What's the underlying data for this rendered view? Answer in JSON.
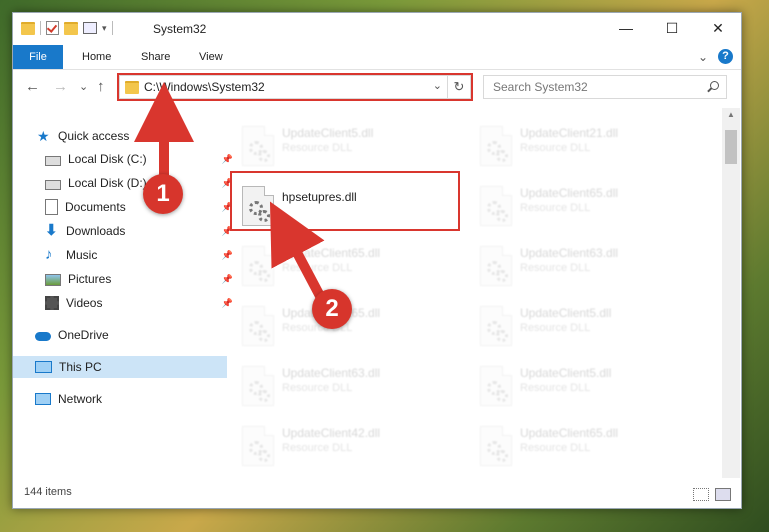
{
  "window": {
    "title": "System32",
    "controls": [
      "—",
      "☐",
      "✕"
    ]
  },
  "ribbon": {
    "tabs": [
      "File",
      "Home",
      "Share",
      "View"
    ],
    "collapse": "⌄",
    "help": "?"
  },
  "navigation": {
    "back": "←",
    "forward": "→",
    "recent": "⌄",
    "up": "↑"
  },
  "address": {
    "path": "C:\\Windows\\System32",
    "dropdown": "⌄",
    "refresh": "↻"
  },
  "search": {
    "placeholder": "Search System32"
  },
  "sidebar": {
    "quick_access": "Quick access",
    "items": [
      {
        "label": "Local Disk (C:)",
        "icon": "drive-icon",
        "pinned": true
      },
      {
        "label": "Local Disk (D:)",
        "icon": "drive-icon",
        "pinned": true
      },
      {
        "label": "Documents",
        "icon": "documents-icon",
        "pinned": true
      },
      {
        "label": "Downloads",
        "icon": "downloads-icon",
        "pinned": true
      },
      {
        "label": "Music",
        "icon": "music-icon",
        "pinned": true
      },
      {
        "label": "Pictures",
        "icon": "pictures-icon",
        "pinned": true
      },
      {
        "label": "Videos",
        "icon": "videos-icon",
        "pinned": true
      }
    ],
    "onedrive": "OneDrive",
    "this_pc": "This PC",
    "network": "Network"
  },
  "files": {
    "highlighted": {
      "name": "hpsetupres.dll"
    },
    "left": [
      {
        "name": "UpdateClient5.dll",
        "type": "Resource DLL"
      },
      {
        "name": "UpdateClient65.dll",
        "type": "Resource DLL"
      },
      {
        "name": "UpdateClient65.dll",
        "type": "Resource DLL"
      },
      {
        "name": "UpdateClient63.dll",
        "type": "Resource DLL"
      },
      {
        "name": "UpdateClient42.dll",
        "type": "Resource DLL"
      }
    ],
    "right": [
      {
        "name": "UpdateClient21.dll",
        "type": "Resource DLL"
      },
      {
        "name": "UpdateClient65.dll",
        "type": "Resource DLL"
      },
      {
        "name": "UpdateClient63.dll",
        "type": "Resource DLL"
      },
      {
        "name": "UpdateClient5.dll",
        "type": "Resource DLL"
      },
      {
        "name": "UpdateClient5.dll",
        "type": "Resource DLL"
      },
      {
        "name": "UpdateClient65.dll",
        "type": "Resource DLL"
      }
    ]
  },
  "status": {
    "count": "144 items"
  },
  "annotations": {
    "step1": "1",
    "step2": "2",
    "color": "#d9362e"
  }
}
